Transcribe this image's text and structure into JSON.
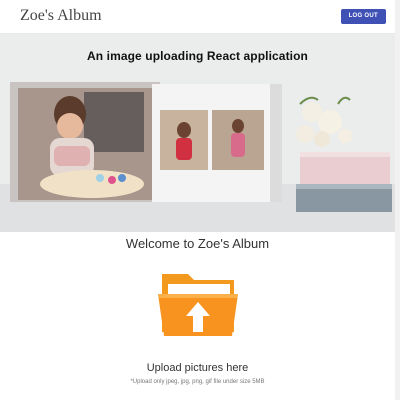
{
  "navbar": {
    "brand": "Zoe's Album",
    "logout_label": "LOG OUT"
  },
  "hero": {
    "caption": "An image uploading React application"
  },
  "main": {
    "welcome": "Welcome to Zoe's Album",
    "upload_title": "Upload pictures here",
    "upload_hint": "*Upload only jpeg, jpg, png, gif file under size 5MB",
    "upload_icon": "folder-upload-icon"
  },
  "colors": {
    "accent": "#3f51b5",
    "folder": "#f7931e"
  }
}
